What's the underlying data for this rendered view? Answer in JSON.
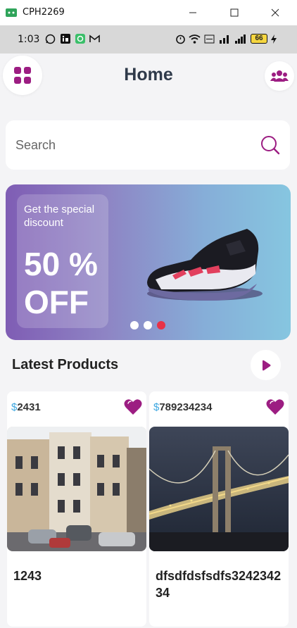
{
  "window": {
    "title": "CPH2269"
  },
  "status_bar": {
    "time": "1:03",
    "battery": "66"
  },
  "header": {
    "title": "Home"
  },
  "search": {
    "placeholder": "Search"
  },
  "banner": {
    "subtitle": "Get the special discount",
    "headline": "50 % OFF",
    "active_dot": 3,
    "dot_count": 3
  },
  "latest": {
    "title": "Latest Products"
  },
  "products": [
    {
      "currency": "$",
      "price": "2431",
      "name": "1243",
      "image": "old-town-street"
    },
    {
      "currency": "$",
      "price": "789234234",
      "name": "dfsdfdsfsdfs324234234",
      "image": "bridge-at-night"
    }
  ],
  "colors": {
    "accent": "#9c1d82",
    "price_currency": "#3ea7e0",
    "active_dot": "#e83248",
    "title": "#2f3a4a"
  },
  "icons": [
    "grid-menu-icon",
    "users-icon",
    "search-icon",
    "heart-icon",
    "play-icon"
  ]
}
